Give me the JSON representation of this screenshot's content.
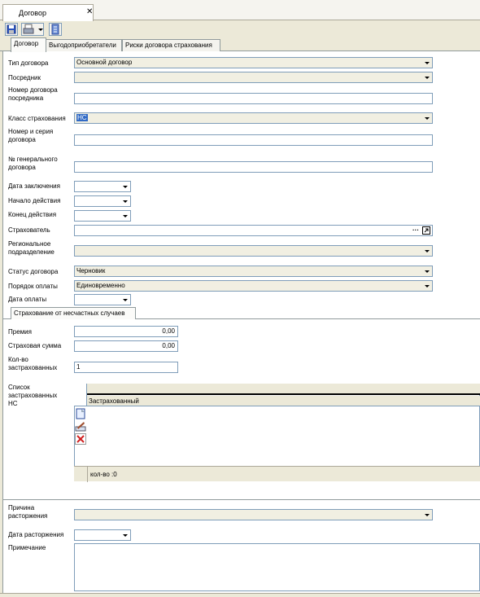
{
  "window": {
    "tab_title": "Договор",
    "tab_close": "✕"
  },
  "toolbar": {
    "icons": [
      "save-icon",
      "print-icon",
      "dropdown-arrow-icon",
      "report-icon"
    ]
  },
  "tabs": [
    {
      "label": "Договор",
      "active": true
    },
    {
      "label": "Выгодоприобретатели",
      "active": false
    },
    {
      "label": "Риски договора страхования",
      "active": false
    }
  ],
  "form": {
    "contract_type": {
      "label": "Тип договора",
      "value": "Основной договор"
    },
    "intermediary": {
      "label": "Посредник",
      "value": ""
    },
    "intermediary_number": {
      "label": "Номер договора\nпосредника",
      "value": ""
    },
    "insurance_class": {
      "label": "Класс страхования",
      "value": "НС"
    },
    "contract_number": {
      "label": "Номер и серия\nдоговора",
      "value": ""
    },
    "general_number": {
      "label": "№ генерального\nдоговора",
      "value": ""
    },
    "conclusion_date": {
      "label": "Дата заключения",
      "value": ""
    },
    "start_date": {
      "label": "Начало действия",
      "value": ""
    },
    "end_date": {
      "label": "Конец действия",
      "value": ""
    },
    "insurer": {
      "label": "Страхователь",
      "value": "",
      "ellipsis": "···"
    },
    "regional_division": {
      "label": "Региональное\nподразделение",
      "value": ""
    },
    "contract_status": {
      "label": "Статус договора",
      "value": "Черновик"
    },
    "payment_order": {
      "label": "Порядок оплаты",
      "value": "Единовременно"
    },
    "payment_date": {
      "label": "Дата оплаты",
      "value": ""
    }
  },
  "section": {
    "tab_label": "Страхование от несчастных случаев",
    "premium": {
      "label": "Премия",
      "value": "0,00"
    },
    "sum_insured": {
      "label": "Страховая сумма",
      "value": "0,00"
    },
    "insured_count": {
      "label": "Кол-во\nзастрахованных",
      "value": "1"
    },
    "insured_list": {
      "label": "Список\nзастрахованных\nНС",
      "column": "Застрахованный",
      "footer": "кол-во :0",
      "buttons": [
        "new-document-icon",
        "edit-icon",
        "delete-icon"
      ]
    }
  },
  "termination": {
    "reason": {
      "label": "Причина\nрасторжения",
      "value": ""
    },
    "date": {
      "label": "Дата расторжения",
      "value": ""
    },
    "note": {
      "label": "Примечание",
      "value": ""
    }
  }
}
